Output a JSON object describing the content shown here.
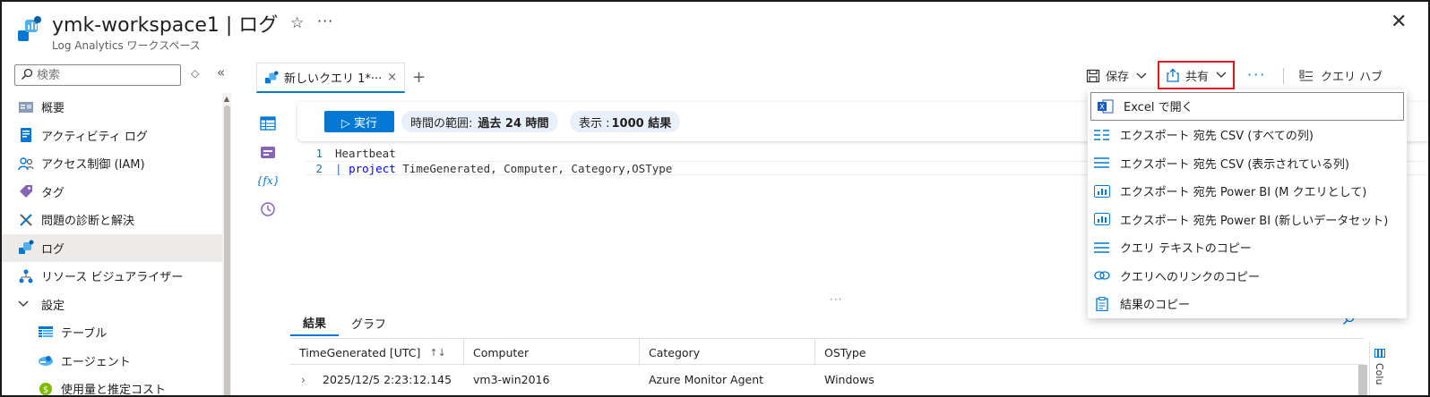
{
  "header": {
    "title": "ymk-workspace1 | ログ",
    "subtitle": "Log Analytics ワークスペース",
    "star": "☆",
    "more": "···",
    "close": "✕"
  },
  "sidebar": {
    "search_placeholder": "検索",
    "sort_icon": "◇",
    "collapse_icon": "«",
    "items": [
      {
        "label": "概要",
        "icon": "overview-icon"
      },
      {
        "label": "アクティビティ ログ",
        "icon": "activity-log-icon"
      },
      {
        "label": "アクセス制御 (IAM)",
        "icon": "iam-icon"
      },
      {
        "label": "タグ",
        "icon": "tag-icon"
      },
      {
        "label": "問題の診断と解決",
        "icon": "diagnose-icon"
      },
      {
        "label": "ログ",
        "icon": "logs-icon",
        "active": true
      },
      {
        "label": "リソース ビジュアライザー",
        "icon": "visualizer-icon"
      },
      {
        "label": "設定",
        "icon": "chevron-down-icon"
      },
      {
        "label": "テーブル",
        "icon": "table-icon"
      },
      {
        "label": "エージェント",
        "icon": "agent-icon"
      },
      {
        "label": "使用量と推定コスト",
        "icon": "usage-icon"
      }
    ]
  },
  "tabs": {
    "active_label": "新しいクエリ 1*···",
    "close": "×",
    "add": "+"
  },
  "toolbar": {
    "save_label": "保存",
    "share_label": "共有",
    "more": "···",
    "query_hub_label": "クエリ ハブ",
    "chevron": "⌄"
  },
  "query": {
    "run_label": "▷ 実行",
    "time_range_label": "時間の範囲:",
    "time_range_value": "過去 24 時間",
    "show_label": "表示 :",
    "show_value": "1000 結果",
    "lines": [
      {
        "num": "1",
        "text": "Heartbeat"
      },
      {
        "num": "2",
        "pipe": "|",
        "keyword": "project",
        "rest": " TimeGenerated, Computer, Category,OSType"
      }
    ],
    "splitter": "···"
  },
  "results": {
    "tabs": [
      "結果",
      "グラフ"
    ],
    "columns": [
      "TimeGenerated [UTC]",
      "Computer",
      "Category",
      "OSType"
    ],
    "sort_icon": "↑↓",
    "rows": [
      {
        "expand": "›",
        "cells": [
          "2025/12/5 2:23:12.145",
          "vm3-win2016",
          "Azure Monitor Agent",
          "Windows"
        ]
      }
    ],
    "columns_panel_label": "Colu"
  },
  "share_menu": {
    "items": [
      {
        "label": "Excel で開く",
        "icon": "excel-icon"
      },
      {
        "label": "エクスポート 宛先 CSV (すべての列)",
        "icon": "csv-all-icon"
      },
      {
        "label": "エクスポート 宛先 CSV (表示されている列)",
        "icon": "csv-visible-icon"
      },
      {
        "label": "エクスポート 宛先 Power BI (M クエリとして)",
        "icon": "powerbi-icon"
      },
      {
        "label": "エクスポート 宛先 Power BI (新しいデータセット)",
        "icon": "powerbi-icon"
      },
      {
        "label": "クエリ テキストのコピー",
        "icon": "copy-text-icon"
      },
      {
        "label": "クエリへのリンクのコピー",
        "icon": "link-icon"
      },
      {
        "label": "結果のコピー",
        "icon": "clipboard-icon"
      }
    ]
  },
  "colors": {
    "accent": "#0078d4",
    "highlight_border": "#e81123",
    "pill_bg": "#e8f0fb"
  }
}
